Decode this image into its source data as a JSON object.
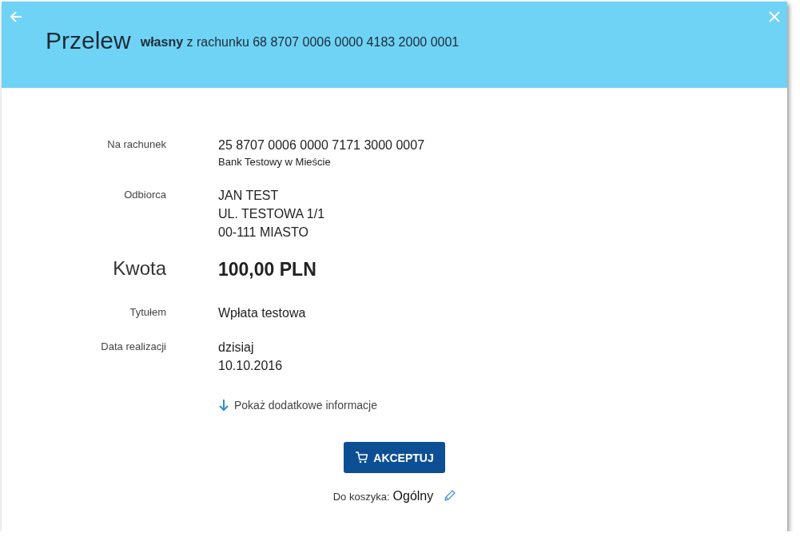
{
  "header": {
    "title": "Przelew",
    "subtitle": "**własny** z rachunku 68 8707 0006 0000 4183 2000 0001"
  },
  "fields": [
    {
      "kind": "account",
      "label": "Na rachunek",
      "lines": [
        "25 8707 0006 0000 7171 3000 0007",
        "Bank Testowy  w Mieście"
      ]
    },
    {
      "kind": "normal",
      "label": "Odbiorca",
      "lines": [
        "JAN TEST",
        "UL. TESTOWA 1/1",
        "00-111 MIASTO"
      ]
    },
    {
      "kind": "amount",
      "label": "Kwota",
      "lines": [
        "100,00  PLN"
      ]
    },
    {
      "kind": "normal",
      "label": "Tytułem",
      "lines": [
        "Wpłata testowa"
      ]
    },
    {
      "kind": "normal",
      "label": "Data realizacji",
      "lines": [
        "dzisiaj",
        "10.10.2016"
      ]
    }
  ],
  "more_link": "Pokaż dodatkowe informacje",
  "accept_button": "AKCEPTUJ",
  "basket": {
    "label": "Do koszyka:",
    "value": "Ogólny"
  }
}
